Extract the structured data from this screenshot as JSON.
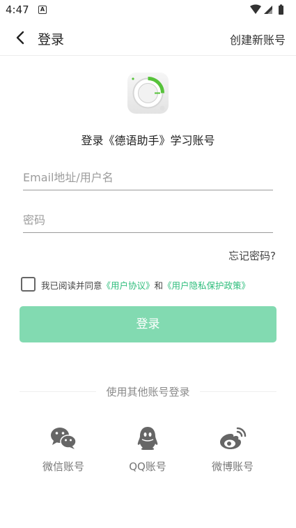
{
  "status_bar": {
    "time": "4:47",
    "app_badge": "A"
  },
  "header": {
    "title": "登录",
    "create_account": "创建新账号"
  },
  "subtitle": "登录《德语助手》学习账号",
  "form": {
    "email_placeholder": "Email地址/用户名",
    "password_placeholder": "密码",
    "forgot": "忘记密码?"
  },
  "agreement": {
    "prefix": "我已阅读并同意",
    "user_agreement": "《用户协议》",
    "conjunction": "和",
    "privacy_policy": "《用户隐私保护政策》",
    "checked": false
  },
  "login_button": "登录",
  "other_login": {
    "label": "使用其他账号登录",
    "options": [
      {
        "label": "微信账号",
        "icon": "wechat-icon"
      },
      {
        "label": "QQ账号",
        "icon": "qq-icon"
      },
      {
        "label": "微博账号",
        "icon": "weibo-icon"
      }
    ]
  },
  "colors": {
    "accent": "#2dbd7b",
    "button_disabled": "#82dab1",
    "icon_gray": "#666666"
  }
}
